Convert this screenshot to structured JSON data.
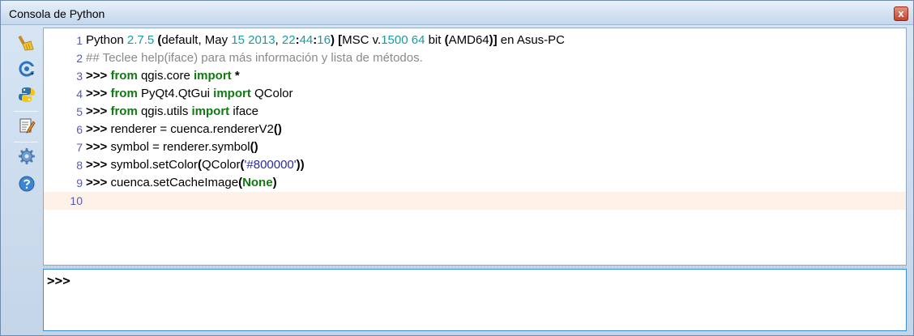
{
  "window": {
    "title": "Consola de Python",
    "close_label": "x"
  },
  "toolbar": {
    "tools": [
      {
        "name": "clear-console",
        "icon": "broom-icon"
      },
      {
        "name": "import-class",
        "icon": "import-class-icon"
      },
      {
        "name": "run-command",
        "icon": "python-icon"
      },
      {
        "name": "show-editor",
        "icon": "editor-icon"
      },
      {
        "name": "settings",
        "icon": "gear-icon"
      },
      {
        "name": "help",
        "icon": "help-icon"
      }
    ]
  },
  "editor": {
    "lines": [
      {
        "number": "1",
        "tokens": [
          {
            "t": "Python ",
            "c": ""
          },
          {
            "t": "2.7.5",
            "c": "num"
          },
          {
            "t": " (",
            "c": "b"
          },
          {
            "t": "default, May ",
            "c": ""
          },
          {
            "t": "15 2013",
            "c": "num"
          },
          {
            "t": ", ",
            "c": ""
          },
          {
            "t": "22",
            "c": "num"
          },
          {
            "t": ":",
            "c": "b"
          },
          {
            "t": "44",
            "c": "num"
          },
          {
            "t": ":",
            "c": "b"
          },
          {
            "t": "16",
            "c": "num"
          },
          {
            "t": ") [",
            "c": "b"
          },
          {
            "t": "MSC v.",
            "c": ""
          },
          {
            "t": "1500 64",
            "c": "num"
          },
          {
            "t": " bit ",
            "c": ""
          },
          {
            "t": "(",
            "c": "b"
          },
          {
            "t": "AMD64",
            "c": ""
          },
          {
            "t": ")]",
            "c": "b"
          },
          {
            "t": " en Asus-PC",
            "c": ""
          }
        ]
      },
      {
        "number": "2",
        "tokens": [
          {
            "t": "## Teclee help(iface) para más información y lista de métodos.",
            "c": "cmt"
          }
        ]
      },
      {
        "number": "3",
        "tokens": [
          {
            "t": ">>> ",
            "c": "b"
          },
          {
            "t": "from",
            "c": "kw"
          },
          {
            "t": " qgis.core ",
            "c": ""
          },
          {
            "t": "import",
            "c": "kw"
          },
          {
            "t": " *",
            "c": "b"
          }
        ]
      },
      {
        "number": "4",
        "tokens": [
          {
            "t": ">>> ",
            "c": "b"
          },
          {
            "t": "from",
            "c": "kw"
          },
          {
            "t": " PyQt4.QtGui ",
            "c": ""
          },
          {
            "t": "import",
            "c": "kw"
          },
          {
            "t": " QColor",
            "c": ""
          }
        ]
      },
      {
        "number": "5",
        "tokens": [
          {
            "t": ">>> ",
            "c": "b"
          },
          {
            "t": "from",
            "c": "kw"
          },
          {
            "t": " qgis.utils ",
            "c": ""
          },
          {
            "t": "import",
            "c": "kw"
          },
          {
            "t": " iface",
            "c": ""
          }
        ]
      },
      {
        "number": "6",
        "tokens": [
          {
            "t": ">>> ",
            "c": "b"
          },
          {
            "t": "renderer = cuenca.rendererV2",
            "c": ""
          },
          {
            "t": "()",
            "c": "b"
          }
        ]
      },
      {
        "number": "7",
        "tokens": [
          {
            "t": ">>> ",
            "c": "b"
          },
          {
            "t": "symbol = renderer.symbol",
            "c": ""
          },
          {
            "t": "()",
            "c": "b"
          }
        ]
      },
      {
        "number": "8",
        "tokens": [
          {
            "t": ">>> ",
            "c": "b"
          },
          {
            "t": "symbol.setColor",
            "c": ""
          },
          {
            "t": "(",
            "c": "b"
          },
          {
            "t": "QColor",
            "c": ""
          },
          {
            "t": "(",
            "c": "b"
          },
          {
            "t": "'#800000'",
            "c": "str"
          },
          {
            "t": "))",
            "c": "b"
          }
        ]
      },
      {
        "number": "9",
        "tokens": [
          {
            "t": ">>> ",
            "c": "b"
          },
          {
            "t": "cuenca.setCacheImage",
            "c": ""
          },
          {
            "t": "(",
            "c": "b"
          },
          {
            "t": "None",
            "c": "kw"
          },
          {
            "t": ")",
            "c": "b"
          }
        ]
      },
      {
        "number": "10",
        "tokens": [],
        "current": true
      }
    ]
  },
  "input": {
    "prompt": ">>>",
    "value": ""
  },
  "colors": {
    "keyword": "#0f7a0f",
    "number": "#1b9aa0",
    "string": "#2a2a9a",
    "comment": "#8a8a8a",
    "line_number": "#5a5ab0",
    "current_line": "#fdf1e8",
    "input_border": "#3c8ddc"
  }
}
